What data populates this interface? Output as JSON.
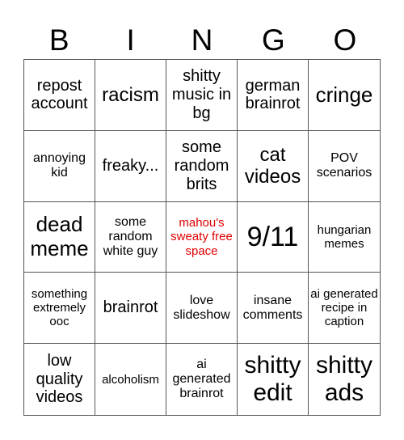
{
  "header": {
    "letters": [
      "B",
      "I",
      "N",
      "G",
      "O"
    ]
  },
  "free_space_color": "#e00000",
  "grid": [
    [
      "repost account",
      "racism",
      "shitty music in bg",
      "german brainrot",
      "cringe"
    ],
    [
      "annoying kid",
      "freaky...",
      "some random brits",
      "cat videos",
      "POV scenarios"
    ],
    [
      "dead meme",
      "some random white guy",
      "mahou's sweaty free space",
      "9/11",
      "hungarian memes"
    ],
    [
      "something extremely ooc",
      "brainrot",
      "love slideshow",
      "insane comments",
      "ai generated recipe in caption"
    ],
    [
      "low quality videos",
      "alcoholism",
      "ai generated brainrot",
      "shitty edit",
      "shitty ads"
    ]
  ]
}
